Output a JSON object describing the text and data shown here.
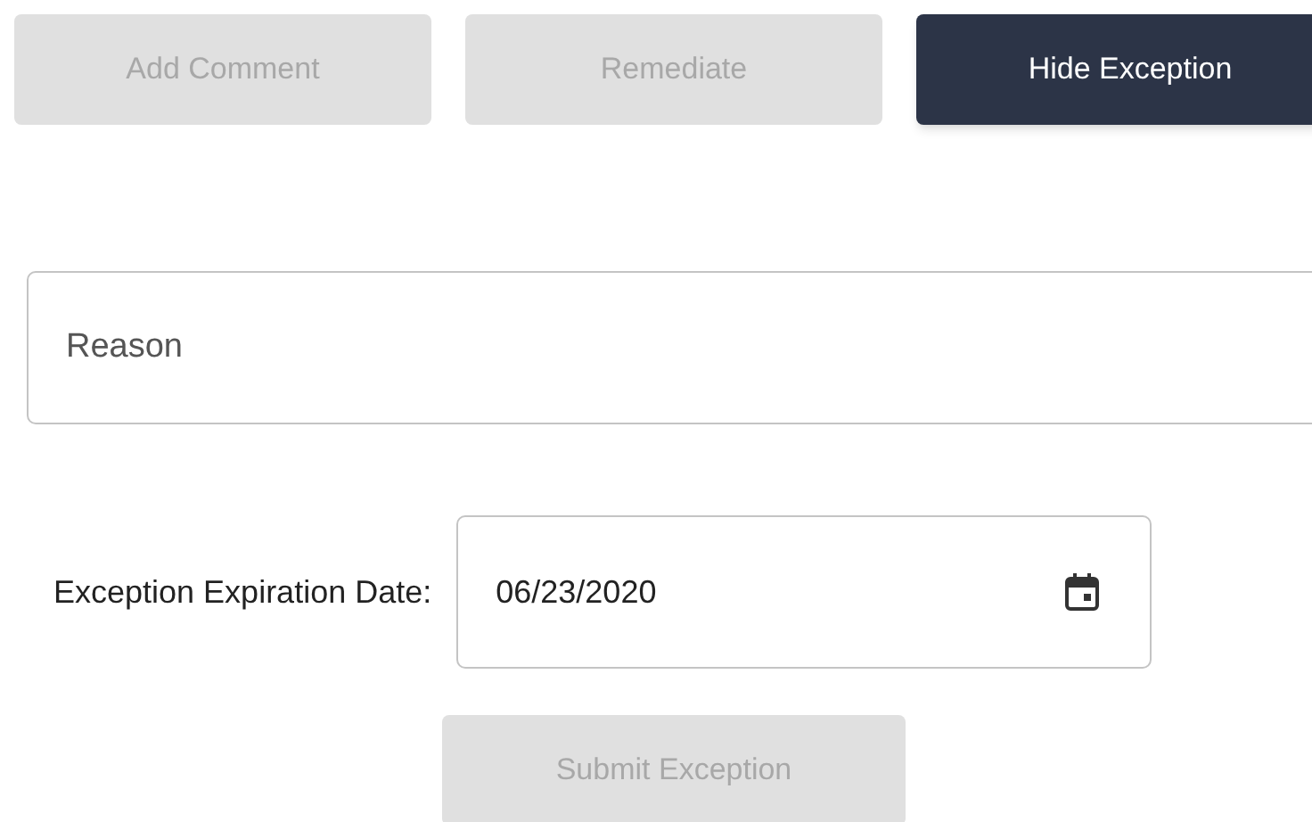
{
  "actions": [
    {
      "label": "Add Comment",
      "disabled": true
    },
    {
      "label": "Remediate",
      "disabled": true
    },
    {
      "label": "Hide Exception",
      "disabled": false
    }
  ],
  "reason": {
    "placeholder": "Reason"
  },
  "expiration": {
    "label": "Exception Expiration Date:",
    "value": "06/23/2020"
  },
  "submit": {
    "label": "Submit Exception",
    "disabled": true
  }
}
